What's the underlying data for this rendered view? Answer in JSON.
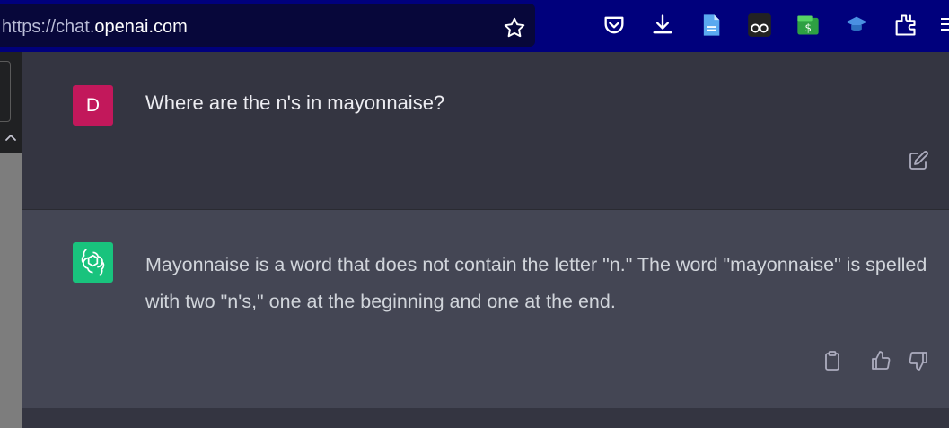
{
  "browser": {
    "url_protocol": "https://chat.",
    "url_domain": "openai.com",
    "icons": [
      "star-icon",
      "pocket-icon",
      "download-icon",
      "document-icon",
      "glasses-icon",
      "wallet-icon",
      "cap-icon",
      "extensions-icon",
      "menu-icon"
    ]
  },
  "conversation": {
    "user": {
      "avatar_initial": "D",
      "avatar_color": "#c2185b",
      "message": "Where are the n's in mayonnaise?"
    },
    "assistant": {
      "avatar_color": "#19c37d",
      "message": "Mayonnaise is a word that does not contain the letter \"n.\" The word \"mayonnaise\" is spelled with two \"n's,\" one at the beginning and one at the end."
    }
  },
  "colors": {
    "toolbar_bg": "#00007c",
    "chat_bg": "#343541",
    "assistant_bg": "#444654"
  }
}
